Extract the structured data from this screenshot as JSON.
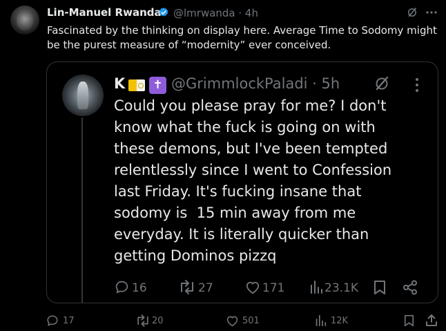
{
  "post": {
    "author_name": "Lin-Manuel Rwanda",
    "handle_time": "@lmrwanda · 4h",
    "text": "Fascinated by the thinking on display here. Average Time to Sodomy might be the purest measure of “modernity” ever conceived.",
    "stats": {
      "replies": "17",
      "reposts": "20",
      "likes": "501",
      "views": "12K"
    }
  },
  "quote": {
    "author_name": "K",
    "cross_glyph": "✝",
    "handle_time": "@GrimmlockPaladi · 5h",
    "text_lines": [
      "Could you please pray for me? I don't",
      "know what the fuck is going on with",
      "these demons, but I've been tempted",
      "relentlessly since I went to Confession",
      "last Friday. It's fucking insane that",
      "sodomy is  15 min away from me",
      "everyday. It is literally quicker than",
      "getting Dominos pizzq"
    ],
    "stats": {
      "replies": "16",
      "reposts": "27",
      "likes": "171",
      "views": "23.1K"
    }
  },
  "colors": {
    "background": "#000000",
    "text": "#e7e9ea",
    "muted": "#71767b",
    "verified": "#1d9bf0",
    "border": "#2f3336"
  },
  "icons": [
    "verified-badge-icon",
    "grok-icon",
    "more-icon",
    "reply-icon",
    "repost-icon",
    "like-icon",
    "views-icon",
    "bookmark-icon",
    "share-icon"
  ]
}
